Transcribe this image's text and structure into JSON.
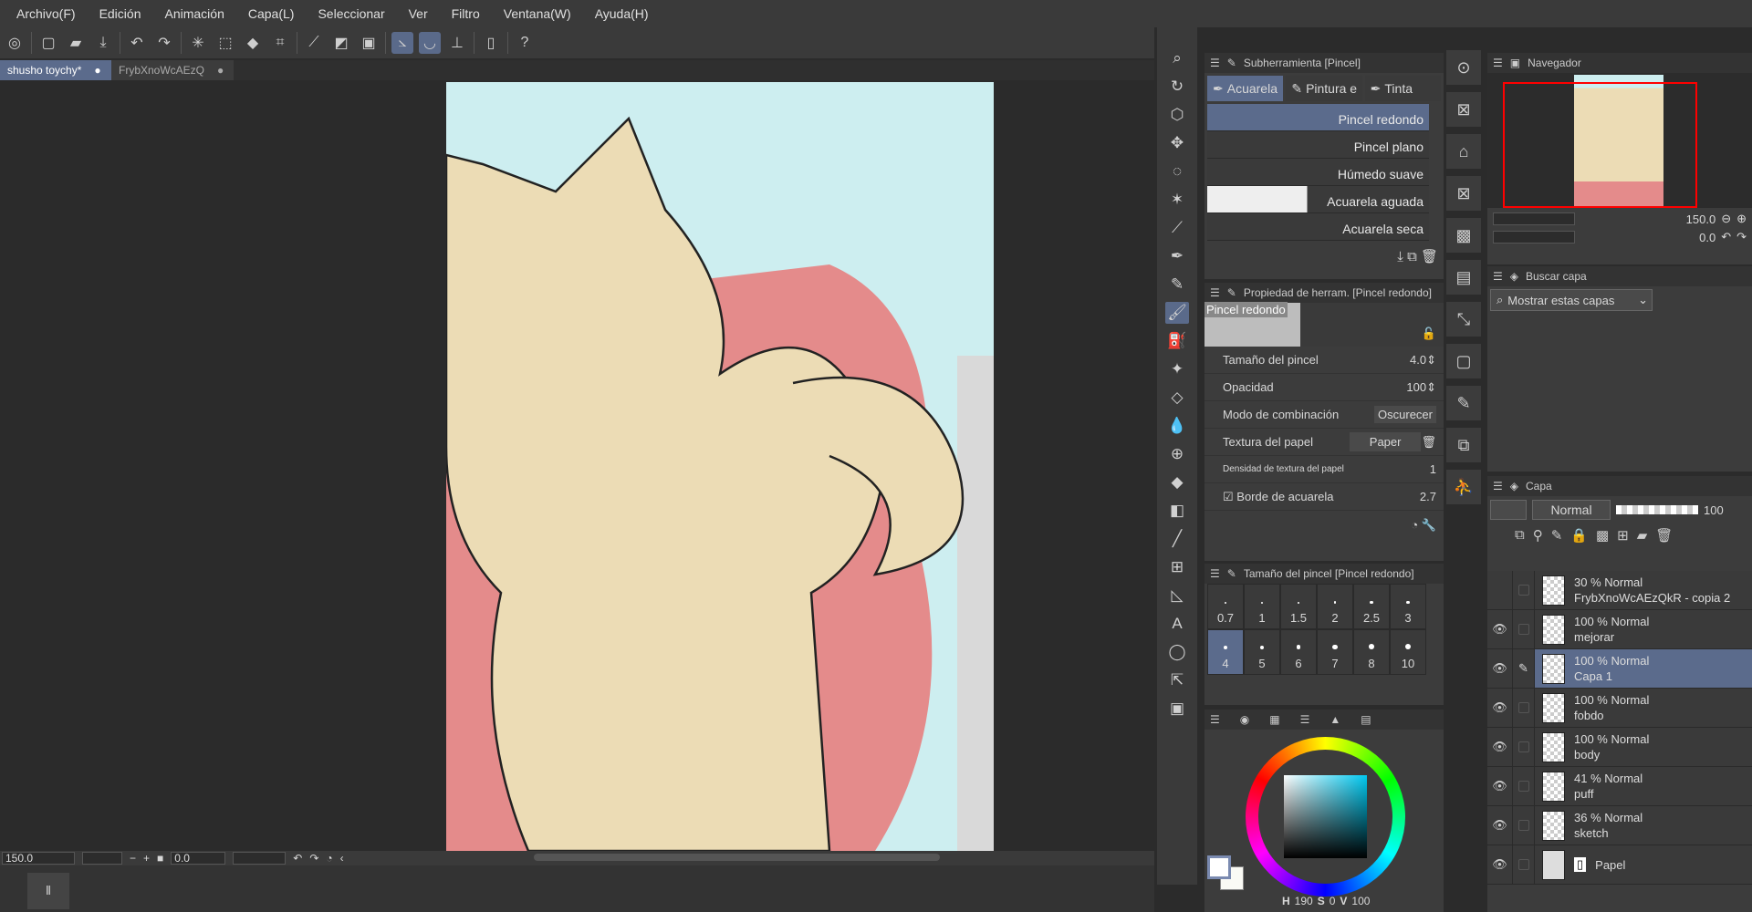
{
  "menu": [
    "Archivo(F)",
    "Edición",
    "Animación",
    "Capa(L)",
    "Seleccionar",
    "Ver",
    "Filtro",
    "Ventana(W)",
    "Ayuda(H)"
  ],
  "tabs": [
    {
      "label": "shusho toychy*",
      "active": true
    },
    {
      "label": "FrybXnoWcAEzQ",
      "active": false
    }
  ],
  "status": {
    "zoom": "150.0",
    "rotation": "0.0"
  },
  "subtool": {
    "title": "Subherramienta [Pincel]",
    "groups": [
      "Acuarela",
      "Pintura e",
      "Tinta"
    ],
    "brushes": [
      "Pincel redondo",
      "Pincel plano",
      "Húmedo suave",
      "Acuarela aguada",
      "Acuarela seca"
    ],
    "selected": "Pincel redondo"
  },
  "toolprop": {
    "title": "Propiedad de herram. [Pincel redondo]",
    "preview_label": "Pincel redondo",
    "size_label": "Tamaño del pincel",
    "size": "4.0",
    "opacity_label": "Opacidad",
    "opacity": "100",
    "blend_label": "Modo de combinación",
    "blend": "Oscurecer",
    "texture_label": "Textura del papel",
    "texture": "Paper",
    "density_label": "Densidad de textura del papel",
    "density": "1",
    "edge_label": "Borde de acuarela",
    "edge": "2.7",
    "edge_checked": true
  },
  "brushsize": {
    "title": "Tamaño del pincel [Pincel redondo]",
    "sizes": [
      "0.7",
      "1",
      "1.5",
      "2",
      "2.5",
      "3",
      "4",
      "5",
      "6",
      "7",
      "8",
      "10"
    ],
    "selected": "4"
  },
  "color": {
    "h_label": "H",
    "h": "190",
    "s_label": "S",
    "s": "0",
    "v_label": "V",
    "v": "100",
    "main": "#ffffff",
    "sub": "#fafaf5"
  },
  "navigator": {
    "title": "Navegador",
    "zoom": "150.0",
    "rotation": "0.0"
  },
  "search": {
    "title": "Buscar capa",
    "filter": "Mostrar estas capas"
  },
  "layers": {
    "title": "Capa",
    "blend": "Normal",
    "opacity": "100",
    "items": [
      {
        "pct": "30 % Normal",
        "name": "FrybXnoWcAEzQkR - copia 2",
        "visible": false,
        "selected": false
      },
      {
        "pct": "100 % Normal",
        "name": "mejorar",
        "visible": true,
        "selected": false
      },
      {
        "pct": "100 % Normal",
        "name": "Capa 1",
        "visible": true,
        "selected": true
      },
      {
        "pct": "100 % Normal",
        "name": "fobdo",
        "visible": true,
        "selected": false
      },
      {
        "pct": "100 % Normal",
        "name": "body",
        "visible": true,
        "selected": false
      },
      {
        "pct": "41 % Normal",
        "name": "puff",
        "visible": true,
        "selected": false
      },
      {
        "pct": "36 % Normal",
        "name": "sketch",
        "visible": true,
        "selected": false
      }
    ],
    "paper": "Papel"
  },
  "colors": {
    "accent": "#5b6b8c",
    "nav_frame": "#ff0000",
    "sky": "#cdeef0",
    "skin": "#ecdcb5",
    "cushion": "#e48b8b"
  }
}
